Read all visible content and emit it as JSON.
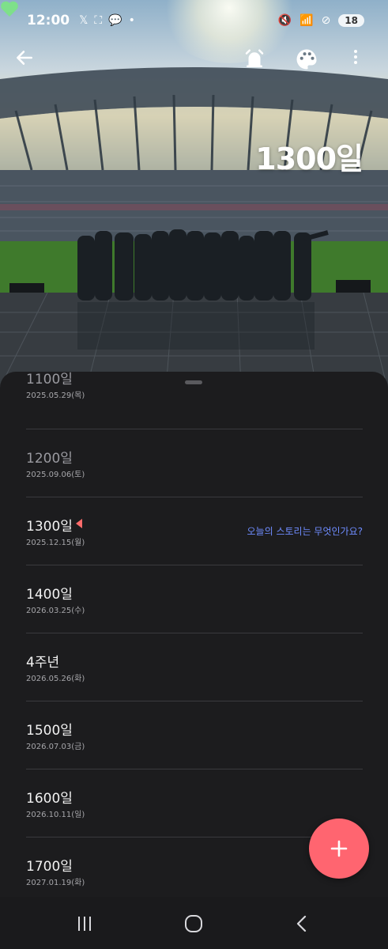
{
  "status_bar": {
    "time": "12:00",
    "battery": "18",
    "left_icons": [
      "x-icon",
      "screenshot-icon",
      "talk-icon",
      "dot-icon"
    ],
    "right_icons": [
      "mute-icon",
      "wifi-icon",
      "block-icon",
      "battery-icon"
    ]
  },
  "toolbar": {
    "back": "back-arrow-icon",
    "actions": [
      "alarm-icon",
      "palette-icon",
      "more-vert-icon"
    ]
  },
  "header": {
    "dday": "1300일",
    "heart_color": "#7ee08a"
  },
  "milestones": [
    {
      "title": "1100일",
      "date": "2025.05.29(목)",
      "state": "past"
    },
    {
      "title": "1200일",
      "date": "2025.09.06(토)",
      "state": "past"
    },
    {
      "title": "1300일",
      "date": "2025.12.15(월)",
      "state": "current",
      "story": "오늘의 스토리는 무엇인가요?"
    },
    {
      "title": "1400일",
      "date": "2026.03.25(수)",
      "state": "future"
    },
    {
      "title": "4주년",
      "date": "2026.05.26(화)",
      "state": "future"
    },
    {
      "title": "1500일",
      "date": "2026.07.03(금)",
      "state": "future"
    },
    {
      "title": "1600일",
      "date": "2026.10.11(일)",
      "state": "future"
    },
    {
      "title": "1700일",
      "date": "2027.01.19(화)",
      "state": "future"
    }
  ],
  "fab": {
    "icon": "plus-icon",
    "color": "#ff6570"
  },
  "navbar": {
    "items": [
      "recent-apps-icon",
      "home-icon",
      "back-icon"
    ]
  },
  "colors": {
    "accent": "#ff6570",
    "link": "#6f8cff",
    "sheet_bg": "#1c1c1e"
  }
}
